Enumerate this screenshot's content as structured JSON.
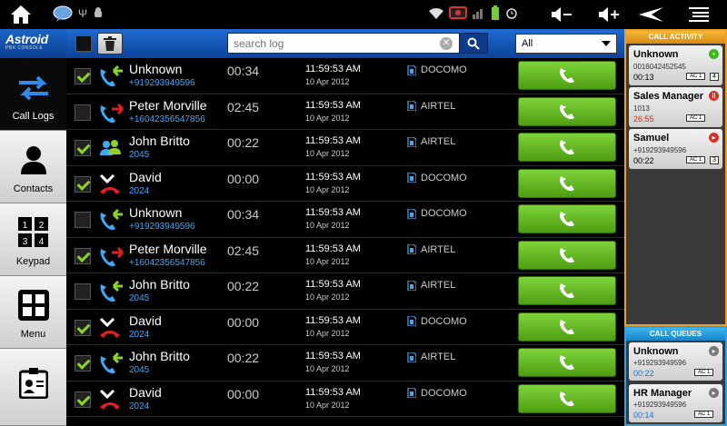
{
  "app": {
    "name": "Astroid",
    "subtitle": "PBX CONSOLE"
  },
  "statusbar": {
    "icons": [
      "home-icon",
      "chat-icon",
      "usb-icon",
      "android-debug-icon",
      "wifi-icon",
      "no-sim-icon",
      "signal-icon",
      "battery-icon",
      "alarm-icon",
      "volume-down-icon",
      "volume-up-icon",
      "back-icon",
      "menu-icon"
    ]
  },
  "nav": [
    {
      "label": "Call Logs",
      "icon": "call-logs-icon",
      "active": true
    },
    {
      "label": "Contacts",
      "icon": "contacts-icon",
      "active": false
    },
    {
      "label": "Keypad",
      "icon": "keypad-icon",
      "active": false
    },
    {
      "label": "Menu",
      "icon": "menu-grid-icon",
      "active": false
    },
    {
      "label": "",
      "icon": "id-card-icon",
      "active": false
    }
  ],
  "toolbar": {
    "search_placeholder": "search log",
    "filter_value": "All"
  },
  "calls": [
    {
      "checked": true,
      "type": "incoming",
      "name": "Unknown",
      "number": "+919293949596",
      "duration": "00:34",
      "time": "11:59:53 AM",
      "date": "10 Apr 2012",
      "operator": "DOCOMO"
    },
    {
      "checked": false,
      "type": "outgoing",
      "name": "Peter Morville",
      "number": "+16042356547856",
      "duration": "02:45",
      "time": "11:59:53 AM",
      "date": "10 Apr 2012",
      "operator": "AIRTEL"
    },
    {
      "checked": true,
      "type": "conference",
      "name": "John Britto",
      "number": "2045",
      "duration": "00:22",
      "time": "11:59:53 AM",
      "date": "10 Apr 2012",
      "operator": "AIRTEL"
    },
    {
      "checked": true,
      "type": "missed",
      "name": "David",
      "number": "2024",
      "duration": "00:00",
      "time": "11:59:53 AM",
      "date": "10 Apr 2012",
      "operator": "DOCOMO"
    },
    {
      "checked": false,
      "type": "incoming",
      "name": "Unknown",
      "number": "+919293949596",
      "duration": "00:34",
      "time": "11:59:53 AM",
      "date": "10 Apr 2012",
      "operator": "DOCOMO"
    },
    {
      "checked": true,
      "type": "outgoing",
      "name": "Peter Morville",
      "number": "+16042356547856",
      "duration": "02:45",
      "time": "11:59:53 AM",
      "date": "10 Apr 2012",
      "operator": "AIRTEL"
    },
    {
      "checked": false,
      "type": "incoming",
      "name": "John Britto",
      "number": "2045",
      "duration": "00:22",
      "time": "11:59:53 AM",
      "date": "10 Apr 2012",
      "operator": "AIRTEL"
    },
    {
      "checked": true,
      "type": "missed",
      "name": "David",
      "number": "2024",
      "duration": "00:00",
      "time": "11:59:53 AM",
      "date": "10 Apr 2012",
      "operator": "DOCOMO"
    },
    {
      "checked": true,
      "type": "incoming",
      "name": "John Britto",
      "number": "2045",
      "duration": "00:22",
      "time": "11:59:53 AM",
      "date": "10 Apr 2012",
      "operator": "AIRTEL"
    },
    {
      "checked": true,
      "type": "missed",
      "name": "David",
      "number": "2024",
      "duration": "00:00",
      "time": "11:59:53 AM",
      "date": "10 Apr 2012",
      "operator": "DOCOMO"
    }
  ],
  "activity": {
    "title": "CALL ACTIVITY",
    "items": [
      {
        "name": "Unknown",
        "number": "0016042452545",
        "time": "00:13",
        "line": "AC 1",
        "count": "4",
        "badge": "+",
        "badge_color": "#3cb521",
        "time_color": "#000000"
      },
      {
        "name": "Sales Manager",
        "number": "1013",
        "time": "26:55",
        "line": "AC 1",
        "count": "",
        "badge": "II",
        "badge_color": "#d93025",
        "time_color": "#d93025"
      },
      {
        "name": "Samuel",
        "number": "+919293949596",
        "time": "00:22",
        "line": "AC 1",
        "count": "3",
        "badge": "▸",
        "badge_color": "#d93025",
        "time_color": "#000000"
      }
    ]
  },
  "queues": {
    "title": "CALL QUEUES",
    "items": [
      {
        "name": "Unknown",
        "number": "+919293949596",
        "time": "00:22",
        "line": "AC 1"
      },
      {
        "name": "HR Manager",
        "number": "+919293949596",
        "time": "00:14",
        "line": "AC 1"
      }
    ]
  },
  "colors": {
    "accent_blue": "#1f6ad2",
    "call_green": "#5cb51e",
    "activity_orange": "#f0a020",
    "queue_blue": "#2aa6e8"
  }
}
